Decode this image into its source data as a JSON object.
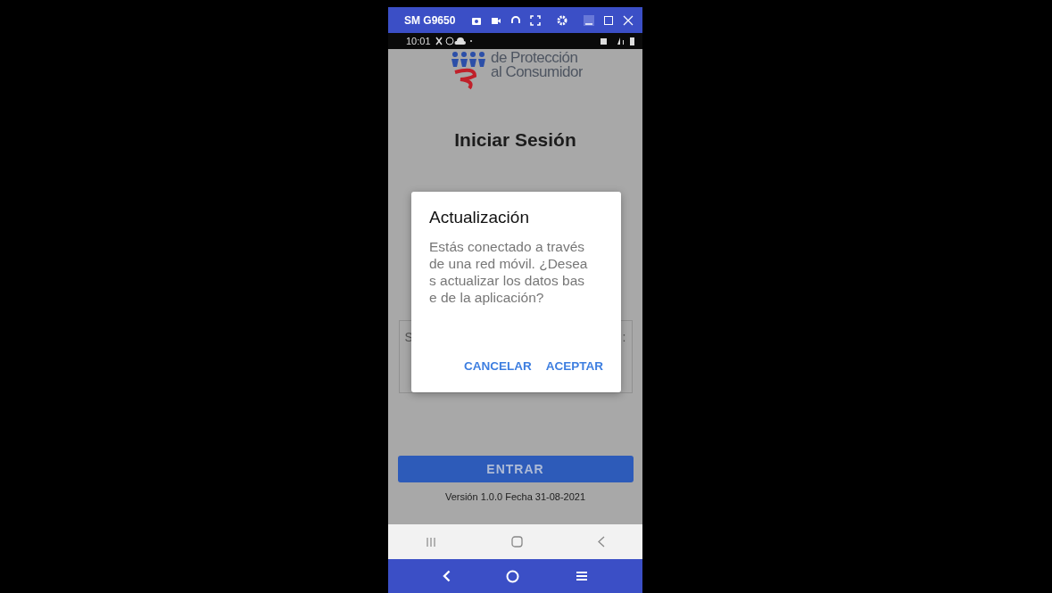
{
  "window": {
    "title": "SM G9650"
  },
  "status_bar": {
    "time": "10:01"
  },
  "screen": {
    "logo_lines": [
      "de Protección",
      "al Consumidor"
    ],
    "heading": "Iniciar Sesión",
    "form_card": {
      "left_text": "S",
      "right_text": ":"
    },
    "login_button": "ENTRAR",
    "version": "Versión 1.0.0 Fecha 31-08-2021"
  },
  "dialog": {
    "title": "Actualización",
    "message": "Estás conectado a través de una red móvil. ¿Deseas actualizar los datos base de la aplicación?",
    "buttons": [
      {
        "label": "CANCELAR"
      },
      {
        "label": "ACEPTAR"
      }
    ]
  }
}
